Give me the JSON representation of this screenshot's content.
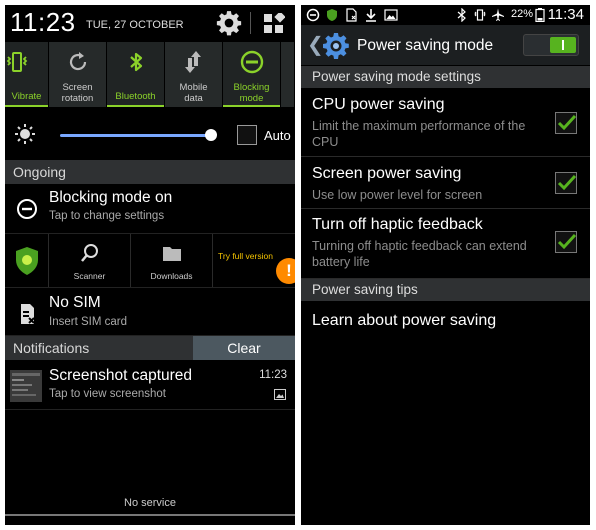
{
  "left": {
    "header": {
      "time": "11:23",
      "date": "TUE, 27 OCTOBER"
    },
    "quick_settings": [
      {
        "label": "Vibrate",
        "icon": "vibrate-icon",
        "active": true
      },
      {
        "label": "Screen\nrotation",
        "icon": "rotation-icon",
        "active": false
      },
      {
        "label": "Bluetooth",
        "icon": "bluetooth-icon",
        "active": true
      },
      {
        "label": "Mobile\ndata",
        "icon": "mobile-data-icon",
        "active": false
      },
      {
        "label": "Blocking\nmode",
        "icon": "blocking-mode-icon",
        "active": true
      }
    ],
    "brightness": {
      "auto_label": "Auto",
      "level": 0.95
    },
    "ongoing_header": "Ongoing",
    "blocking_notification": {
      "title": "Blocking mode on",
      "subtitle": "Tap to change settings"
    },
    "app_widget": {
      "scanner": "Scanner",
      "downloads": "Downloads",
      "try_full": "Try full version",
      "badge": "!"
    },
    "nosim_notification": {
      "title": "No SIM",
      "subtitle": "Insert SIM card"
    },
    "notifications_header": "Notifications",
    "clear_label": "Clear",
    "screenshot_notification": {
      "title": "Screenshot captured",
      "subtitle": "Tap to view screenshot",
      "time": "11:23"
    },
    "no_service": "No service"
  },
  "right": {
    "status": {
      "battery": "22%",
      "time": "11:34"
    },
    "title": "Power saving mode",
    "settings_header": "Power saving mode settings",
    "items": [
      {
        "title": "CPU power saving",
        "subtitle": "Limit the maximum performance of the CPU",
        "checked": true
      },
      {
        "title": "Screen power saving",
        "subtitle": "Use low power level for screen",
        "checked": true
      },
      {
        "title": "Turn off haptic feedback",
        "subtitle": "Turning off haptic feedback can extend battery life",
        "checked": true
      }
    ],
    "tips_header": "Power saving tips",
    "learn": "Learn about power saving"
  },
  "colors": {
    "accent_green": "#8bd22a",
    "check_green": "#57b31f",
    "warning_orange": "#ff8a00",
    "slider_blue": "#7aa8ff"
  }
}
